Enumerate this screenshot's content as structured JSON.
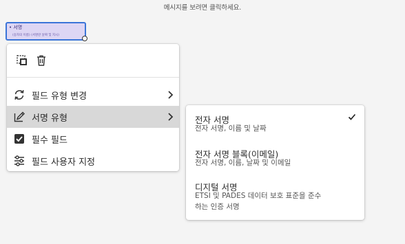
{
  "hint": {
    "text": "메시지를 보려면 클릭하세요."
  },
  "field": {
    "label": "• 서명",
    "sublabel": "(승자의 이름) (서명란 날짜 및 지시)"
  },
  "toolbar": {
    "icons": [
      "duplicate-icon",
      "trash-icon"
    ]
  },
  "menu": {
    "items": [
      {
        "label": "필드 유형 변경",
        "icon": "refresh-icon",
        "has_submenu": true,
        "active": false
      },
      {
        "label": "서명 유형",
        "icon": "signature-pen-icon",
        "has_submenu": true,
        "active": true
      },
      {
        "label": "필수 필드",
        "icon": "checkbox-checked-icon",
        "has_submenu": false,
        "active": false
      },
      {
        "label": "필드 사용자 지정",
        "icon": "sliders-icon",
        "has_submenu": false,
        "active": false
      }
    ]
  },
  "submenu": {
    "items": [
      {
        "title": "전자 서명",
        "desc_line1": "전자 서명, 이름 및 날짜",
        "desc_line2": "",
        "checked": true
      },
      {
        "title": "전자 서명 블록(이메일)",
        "desc_line1": "전자 서명, 이름, 날짜 및 이메일",
        "desc_line2": "",
        "checked": false
      },
      {
        "title": "디지털 서명",
        "desc_line1": "ETSI 및 PADES 데이터 보호 표준을 준수",
        "desc_line2": "하는 인증 서명",
        "checked": false
      }
    ]
  },
  "colors": {
    "field_border": "#3a74d8",
    "field_fill": "#ddd6f4",
    "active_row": "#d8d8d8"
  }
}
